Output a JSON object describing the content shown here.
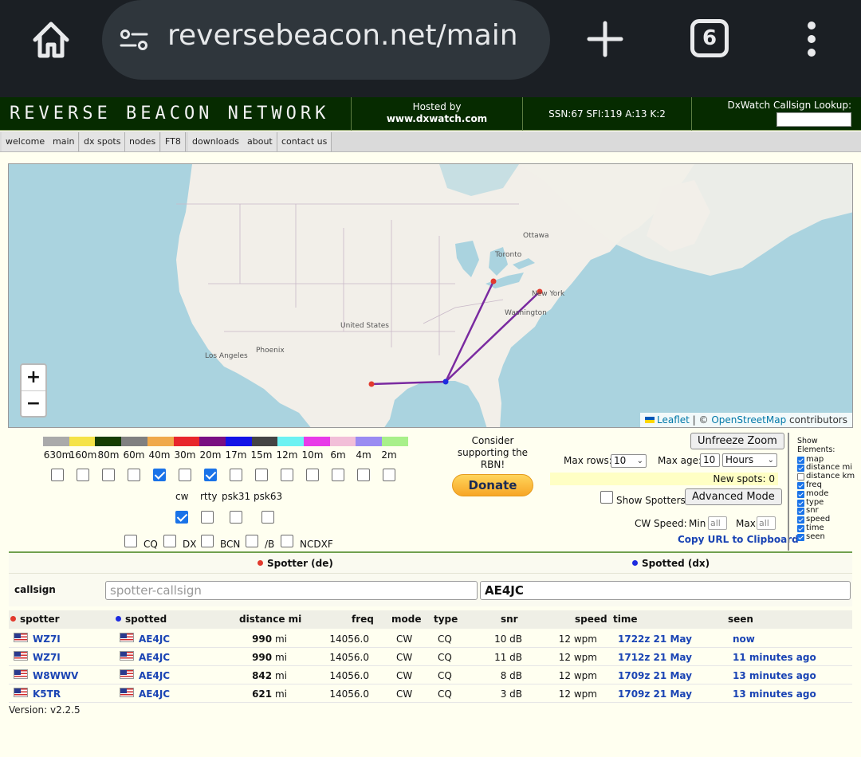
{
  "browser": {
    "url": "reversebeacon.net/main",
    "tab_count": "6"
  },
  "header": {
    "logo": "REVERSE BEACON NETWORK",
    "hosted_label": "Hosted by",
    "hosted_site": "www.dxwatch.com",
    "conditions": "SSN:67 SFI:119 A:13 K:2",
    "lookup_label": "DxWatch Callsign Lookup:"
  },
  "nav": [
    "welcome",
    "main",
    "dx spots",
    "nodes",
    "FT8",
    "downloads",
    "about",
    "contact us"
  ],
  "map": {
    "labels": [
      "Ottawa",
      "Toronto",
      "New York",
      "Washington",
      "United States",
      "Phoenix",
      "Los Angeles"
    ],
    "zoom_in": "+",
    "zoom_out": "−",
    "attribution_leaflet": "Leaflet",
    "attribution_sep": " | © ",
    "attribution_osm": "OpenStreetMap",
    "attribution_tail": " contributors"
  },
  "bands": [
    {
      "label": "630m",
      "color": "#aaaaaa",
      "checked": false
    },
    {
      "label": "160m",
      "color": "#f5e347",
      "checked": false
    },
    {
      "label": "80m",
      "color": "#163d00",
      "checked": false
    },
    {
      "label": "60m",
      "color": "#808080",
      "checked": false
    },
    {
      "label": "40m",
      "color": "#f0a94b",
      "checked": true
    },
    {
      "label": "30m",
      "color": "#e8262b",
      "checked": false
    },
    {
      "label": "20m",
      "color": "#7a0f82",
      "checked": true
    },
    {
      "label": "17m",
      "color": "#1414e6",
      "checked": false
    },
    {
      "label": "15m",
      "color": "#444444",
      "checked": false
    },
    {
      "label": "12m",
      "color": "#6cf2f2",
      "checked": false
    },
    {
      "label": "10m",
      "color": "#e83be8",
      "checked": false
    },
    {
      "label": "6m",
      "color": "#f2bfd8",
      "checked": false
    },
    {
      "label": "4m",
      "color": "#9a8cf2",
      "checked": false
    },
    {
      "label": "2m",
      "color": "#a8f08a",
      "checked": false
    }
  ],
  "modes": [
    {
      "label": "cw",
      "checked": true
    },
    {
      "label": "rtty",
      "checked": false
    },
    {
      "label": "psk31",
      "checked": false
    },
    {
      "label": "psk63",
      "checked": false
    }
  ],
  "types": [
    "CQ",
    "DX",
    "BCN",
    "/B",
    "NCDXF"
  ],
  "donate": {
    "text": "Consider supporting the RBN!",
    "button": "Donate"
  },
  "controls": {
    "unfreeze": "Unfreeze Zoom",
    "max_rows_label": "Max rows:",
    "max_rows": "10",
    "max_age_label": "Max age:",
    "max_age": "10",
    "age_unit": "Hours",
    "new_spots": "New spots: 0",
    "show_spotters": "Show Spotters",
    "advanced": "Advanced Mode",
    "cw_speed": "CW Speed:",
    "min": "Min",
    "max": "Max",
    "all": "all",
    "copy_url": "Copy URL to Clipboard"
  },
  "show_elements": {
    "title": "Show Elements:",
    "items": [
      {
        "label": "map",
        "checked": true
      },
      {
        "label": "distance mi",
        "checked": true
      },
      {
        "label": "distance km",
        "checked": false
      },
      {
        "label": "freq",
        "checked": true
      },
      {
        "label": "mode",
        "checked": true
      },
      {
        "label": "type",
        "checked": true
      },
      {
        "label": "snr",
        "checked": true
      },
      {
        "label": "speed",
        "checked": true
      },
      {
        "label": "time",
        "checked": true
      },
      {
        "label": "seen",
        "checked": true
      }
    ]
  },
  "filter": {
    "spotter_header": "Spotter (de)",
    "spotted_header": "Spotted (dx)",
    "row_label": "callsign",
    "spotter_placeholder": "spotter-callsign",
    "spotted_value": "AE4JC"
  },
  "table": {
    "headers": {
      "spotter": "spotter",
      "spotted": "spotted",
      "distance": "distance mi",
      "freq": "freq",
      "mode": "mode",
      "type": "type",
      "snr": "snr",
      "speed": "speed",
      "time": "time",
      "seen": "seen"
    },
    "rows": [
      {
        "spotter": "WZ7I",
        "spotted": "AE4JC",
        "distance": "990",
        "unit": "mi",
        "freq": "14056.0",
        "mode": "CW",
        "type": "CQ",
        "snr": "10 dB",
        "speed": "12 wpm",
        "time": "1722z 21 May",
        "seen": "now"
      },
      {
        "spotter": "WZ7I",
        "spotted": "AE4JC",
        "distance": "990",
        "unit": "mi",
        "freq": "14056.0",
        "mode": "CW",
        "type": "CQ",
        "snr": "11 dB",
        "speed": "12 wpm",
        "time": "1712z 21 May",
        "seen": "11 minutes ago"
      },
      {
        "spotter": "W8WWV",
        "spotted": "AE4JC",
        "distance": "842",
        "unit": "mi",
        "freq": "14056.0",
        "mode": "CW",
        "type": "CQ",
        "snr": "8 dB",
        "speed": "12 wpm",
        "time": "1709z 21 May",
        "seen": "13 minutes ago"
      },
      {
        "spotter": "K5TR",
        "spotted": "AE4JC",
        "distance": "621",
        "unit": "mi",
        "freq": "14056.0",
        "mode": "CW",
        "type": "CQ",
        "snr": "3 dB",
        "speed": "12 wpm",
        "time": "1709z 21 May",
        "seen": "13 minutes ago"
      }
    ]
  },
  "version": "Version: v2.2.5"
}
